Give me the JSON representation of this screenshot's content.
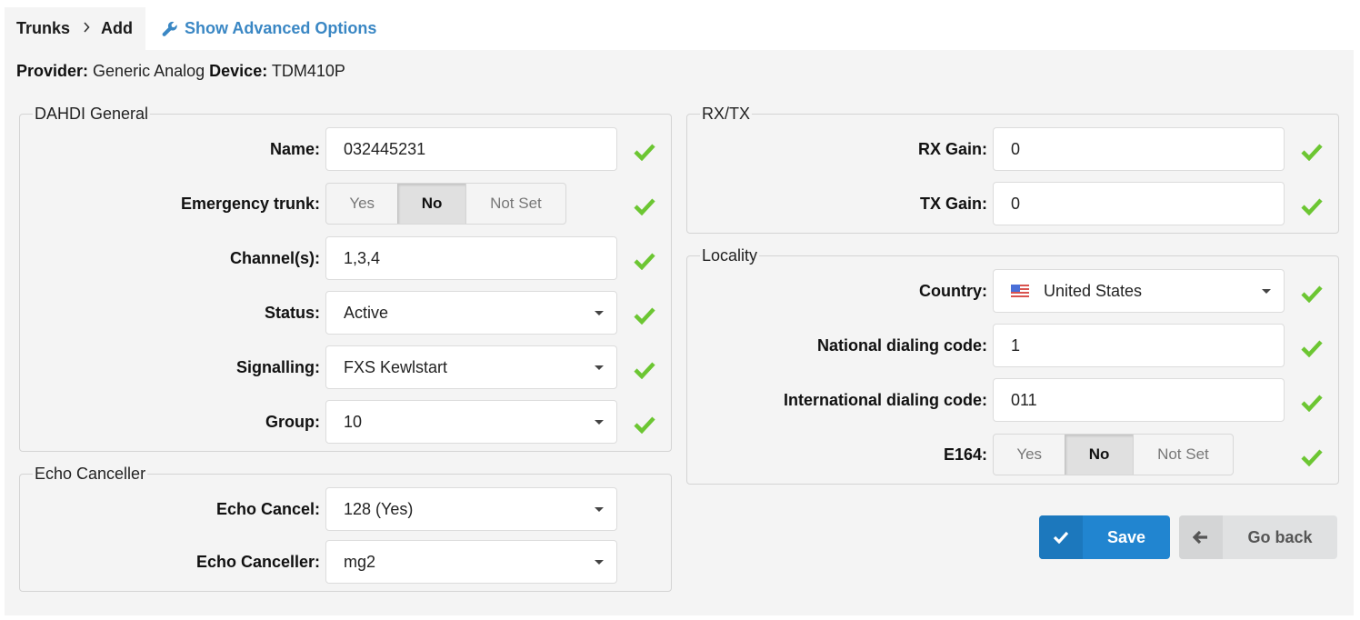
{
  "breadcrumb": {
    "parent": "Trunks",
    "separator": ">",
    "current": "Add"
  },
  "advanced_options_link": "Show Advanced Options",
  "provider_line": {
    "provider_label": "Provider:",
    "provider_value": "Generic Analog",
    "device_label": "Device:",
    "device_value": "TDM410P"
  },
  "dahdi_general": {
    "legend": "DAHDI General",
    "name": {
      "label": "Name:",
      "value": "032445231"
    },
    "emergency_trunk": {
      "label": "Emergency trunk:",
      "options": [
        "Yes",
        "No",
        "Not Set"
      ],
      "selected": "No"
    },
    "channels": {
      "label": "Channel(s):",
      "value": "1,3,4"
    },
    "status": {
      "label": "Status:",
      "value": "Active"
    },
    "signalling": {
      "label": "Signalling:",
      "value": "FXS Kewlstart"
    },
    "group": {
      "label": "Group:",
      "value": "10"
    }
  },
  "echo_canceller": {
    "legend": "Echo Canceller",
    "echo_cancel": {
      "label": "Echo Cancel:",
      "value": "128 (Yes)"
    },
    "echo_canceller": {
      "label": "Echo Canceller:",
      "value": "mg2"
    }
  },
  "rxtx": {
    "legend": "RX/TX",
    "rx_gain": {
      "label": "RX Gain:",
      "value": "0"
    },
    "tx_gain": {
      "label": "TX Gain:",
      "value": "0"
    }
  },
  "locality": {
    "legend": "Locality",
    "country": {
      "label": "Country:",
      "value": "United States",
      "flag": "us-flag"
    },
    "national_code": {
      "label": "National dialing code:",
      "value": "1"
    },
    "international_code": {
      "label": "International dialing code:",
      "value": "011"
    },
    "e164": {
      "label": "E164:",
      "options": [
        "Yes",
        "No",
        "Not Set"
      ],
      "selected": "No"
    }
  },
  "actions": {
    "save": "Save",
    "go_back": "Go back"
  },
  "colors": {
    "accent_link": "#3a87c4",
    "valid_check": "#6cc632",
    "save_button": "#2185d0",
    "back_button": "#e0e1e2",
    "panel_bg": "#f4f4f4"
  }
}
